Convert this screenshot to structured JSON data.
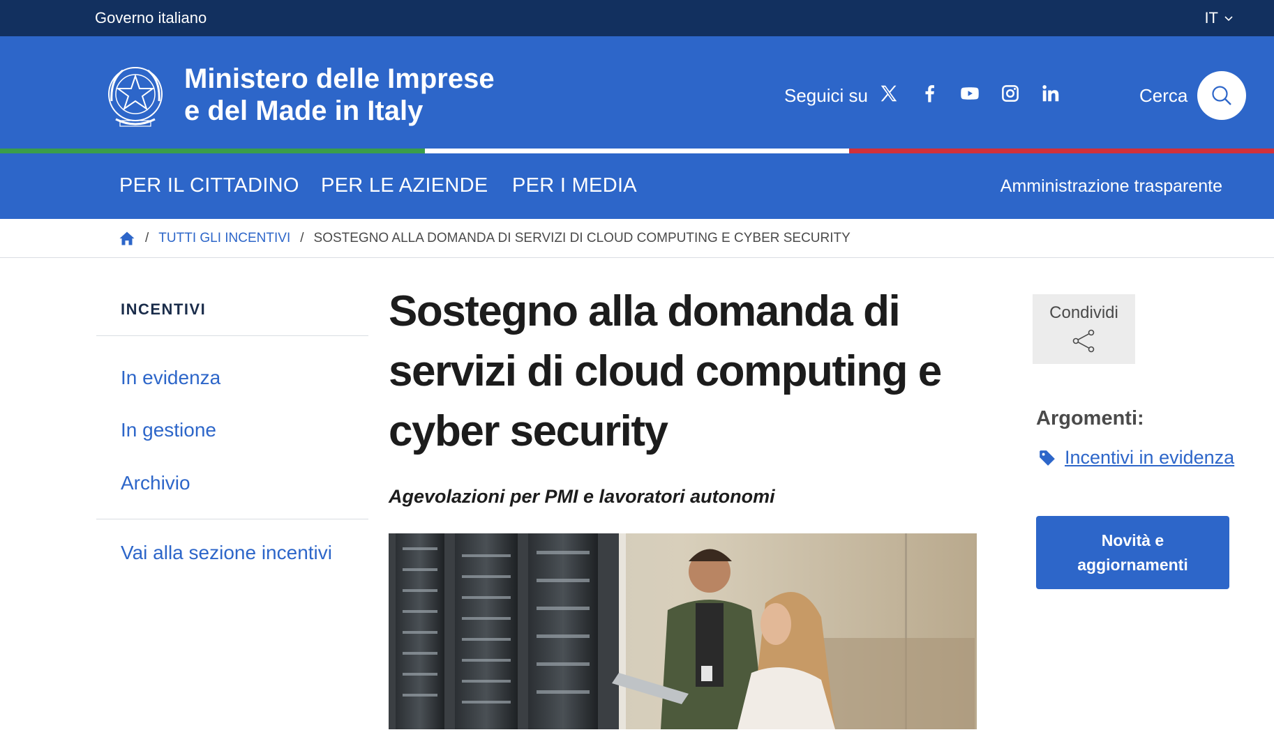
{
  "topbar": {
    "gov_label": "Governo italiano",
    "lang": "IT"
  },
  "header": {
    "title_line1": "Ministero delle Imprese",
    "title_line2": "e del Made in Italy",
    "follow_label": "Seguici su",
    "socials": [
      "x-twitter-icon",
      "facebook-icon",
      "youtube-icon",
      "instagram-icon",
      "linkedin-icon"
    ],
    "search_label": "Cerca"
  },
  "colors": {
    "primary": "#2d66c9",
    "dark": "#12305f",
    "green": "#3a9d4a",
    "white": "#ffffff",
    "red": "#d1313a"
  },
  "nav": {
    "items": [
      "PER IL CITTADINO",
      "PER LE AZIENDE",
      "PER I MEDIA"
    ],
    "right": "Amministrazione trasparente"
  },
  "breadcrumb": {
    "link": "TUTTI GLI INCENTIVI",
    "current": "SOSTEGNO ALLA DOMANDA DI SERVIZI DI CLOUD COMPUTING E CYBER SECURITY"
  },
  "sidebar": {
    "title": "INCENTIVI",
    "items": [
      "In evidenza",
      "In gestione",
      "Archivio"
    ],
    "section_link": "Vai alla sezione incentivi"
  },
  "article": {
    "title_lines": [
      "Sostegno alla domanda di",
      "servizi di cloud computing e",
      "cyber security"
    ],
    "subtitle": "Agevolazioni per PMI e lavoratori autonomi"
  },
  "aside": {
    "share_label": "Condividi",
    "topics_title": "Argomenti:",
    "topic_link": "Incentivi in evidenza",
    "news_button": "Novità e aggiornamenti"
  }
}
